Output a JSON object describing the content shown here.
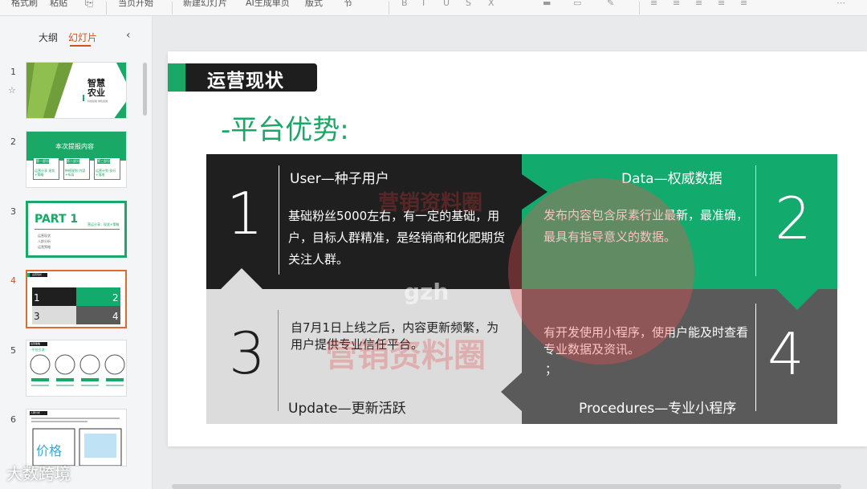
{
  "toolbar": {
    "items": [
      "格式刷",
      "粘贴",
      "当页开始",
      "新建幻灯片",
      "AI生成单页",
      "版式",
      "节"
    ]
  },
  "left_panel": {
    "tabs": [
      "大纲",
      "幻灯片"
    ],
    "active_tab": "幻灯片",
    "slides": [
      {
        "num": "1",
        "title": "智慧农业",
        "sub": "科技赋能·绿色发展"
      },
      {
        "num": "2",
        "title": "本次提报内容",
        "cells": [
          "第一部分",
          "第二部分",
          "第三部分"
        ],
        "captions": [
          "运营分享 现状+策略",
          "种植规划 内容+布局",
          "运营计划 执行+落地"
        ]
      },
      {
        "num": "3",
        "title": "PART 1",
        "sub": "营运分享：现状+策略",
        "bullets": [
          "运营现状",
          "人群分析",
          "运营策略"
        ]
      },
      {
        "num": "4",
        "title": "运营现状"
      },
      {
        "num": "5",
        "title": "运营策略",
        "sub": "-平台引流："
      },
      {
        "num": "6",
        "title": "人群分析",
        "sub": "价格"
      }
    ]
  },
  "slide": {
    "title": "运营现状",
    "subtitle": "-平台优势:",
    "q1": {
      "num": "1",
      "title": "User—种子用户",
      "body": "基础粉丝5000左右，有一定的基础，用户，目标人群精准，是经销商和化肥期货关注人群。"
    },
    "q2": {
      "num": "2",
      "title": "Data—权威数据",
      "body": "发布内容包含尿素行业最新，最准确，最具有指导意义的数据。"
    },
    "q3": {
      "num": "3",
      "title": "Update—更新活跃",
      "body": "自7月1日上线之后，内容更新频繁，为用户提供专业信任平台。"
    },
    "q4": {
      "num": "4",
      "title": "Procedures—专业小程序",
      "body": "有开发使用小程序，使用户能及时查看专业数据及资讯。",
      "extra": "；"
    }
  },
  "watermark": {
    "line1": "营销资料圈",
    "line2": "gzh"
  },
  "corner_logo": "大数跨境",
  "colors": {
    "green": "#13ab6d",
    "dark": "#1f1f1f",
    "gray": "#5a5a5a",
    "light": "#dcdcdc",
    "accent": "#d0531b"
  }
}
